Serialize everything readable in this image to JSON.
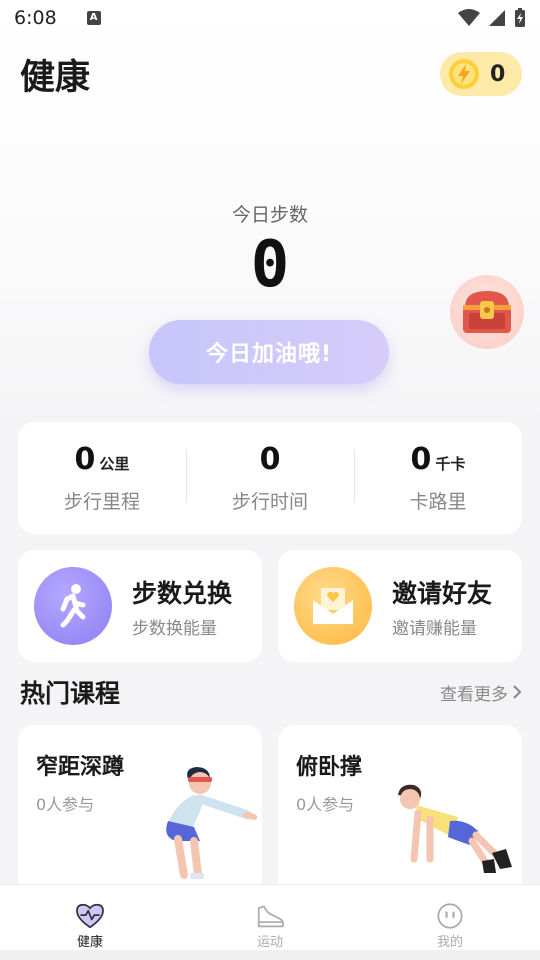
{
  "status": {
    "time": "6:08",
    "notif_glyph": "A"
  },
  "header": {
    "title": "健康",
    "coin_count": "0"
  },
  "steps": {
    "label": "今日步数",
    "value": "0",
    "cheer_label": "今日加油哦!"
  },
  "stats": [
    {
      "value": "0",
      "unit": "公里",
      "label": "步行里程"
    },
    {
      "value": "0",
      "unit": "",
      "label": "步行时间"
    },
    {
      "value": "0",
      "unit": "千卡",
      "label": "卡路里"
    }
  ],
  "features": [
    {
      "title": "步数兑换",
      "subtitle": "步数换能量",
      "icon": "walker-icon"
    },
    {
      "title": "邀请好友",
      "subtitle": "邀请赚能量",
      "icon": "envelope-icon"
    }
  ],
  "courses_section": {
    "title": "热门课程",
    "more_label": "查看更多"
  },
  "courses": [
    {
      "title": "窄距深蹲",
      "participants": "0人参与"
    },
    {
      "title": "俯卧撑",
      "participants": "0人参与"
    }
  ],
  "tabs": [
    {
      "label": "健康",
      "icon": "heart-pulse-icon",
      "active": true
    },
    {
      "label": "运动",
      "icon": "sneaker-icon",
      "active": false
    },
    {
      "label": "我的",
      "icon": "face-icon",
      "active": false
    }
  ],
  "colors": {
    "cheer_button": "#c7c5fb",
    "walker_icon_bg": "#9a8cf6",
    "envelope_icon_bg": "#ffc15a",
    "coin_pill": "#fde9a8"
  }
}
